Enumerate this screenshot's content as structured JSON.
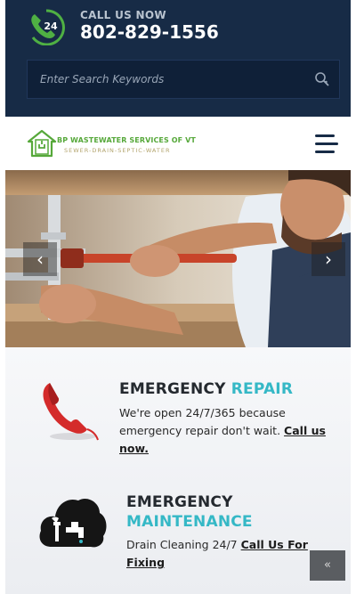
{
  "topbar": {
    "call_label": "CALL US NOW",
    "phone_number": "802-829-1556",
    "phone_icon_text": "24",
    "phone_icon": "phone-24-icon",
    "search_placeholder": "Enter Search Keywords",
    "search_icon": "search-icon"
  },
  "header": {
    "logo_title": "BP WASTEWATER SERVICES OF VT",
    "logo_tagline": "SEWER-DRAIN-SEPTIC-WATER",
    "logo_icon": "house-logo-icon",
    "menu_icon": "hamburger-menu-icon"
  },
  "slider": {
    "prev_label": "‹",
    "next_label": "›"
  },
  "services": [
    {
      "icon": "red-telephone-icon",
      "title_main": "EMERGENCY",
      "title_accent": "REPAIR",
      "text": "We're open 24/7/365 because emergency repair don't wait.",
      "link": "Call us now."
    },
    {
      "icon": "wrench-faucet-cloud-icon",
      "title_main": "EMERGENCY",
      "title_accent": "MAINTENANCE",
      "text": "Drain Cleaning 24/7",
      "link": "Call Us For Fixing"
    }
  ],
  "scroll_top": {
    "label": "«",
    "icon": "chevron-up-icon"
  },
  "colors": {
    "navy": "#172b46",
    "accent_teal": "#35b8c6",
    "logo_green": "#56a83a",
    "phone_red": "#d42b2b"
  }
}
